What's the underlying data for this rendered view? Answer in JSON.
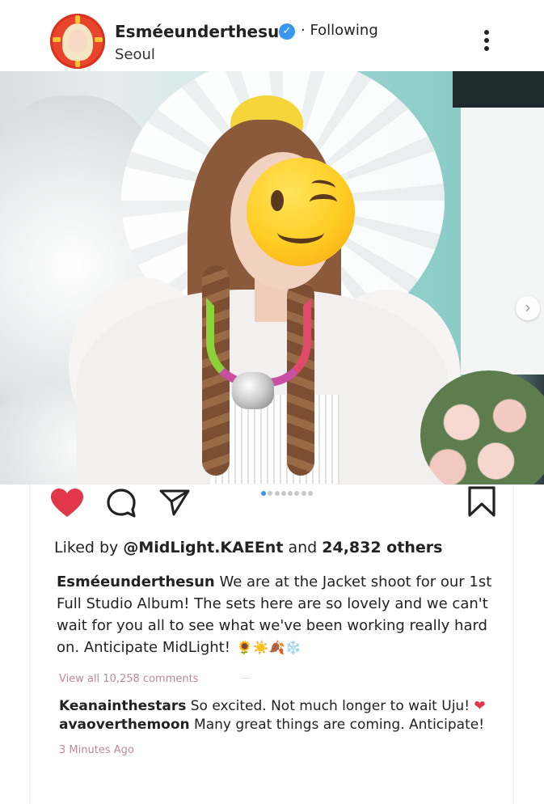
{
  "post": {
    "username": "Esméeunderthesun",
    "following_label": "· Following",
    "location": "Seoul",
    "liked_by_prefix": "Liked by",
    "liked_by_user": "@MidLight.KAEEnt",
    "liked_by_and": "and",
    "liked_by_others": "24,832 others",
    "caption_user": "Esméeunderthesun",
    "caption_text": "We are at the Jacket shoot for our 1st Full Studio Album! The sets here are so lovely and we can't wait for you all to see what we've been working really hard on. Anticipate MidLight!",
    "caption_emojis": "🌻☀️🍂❄️",
    "view_comments": "View all 10,258 comments",
    "comments": [
      {
        "user": "Keanainthestars",
        "text": "So excited. Not much longer to wait Uju!",
        "emoji": "❤"
      },
      {
        "user": "avaoverthemoon",
        "text": "Many great things are coming. Anticipate!",
        "emoji": ""
      }
    ],
    "timestamp": "3 Minutes Ago",
    "carousel": {
      "count": 8,
      "active_index": 0
    }
  },
  "icons": {
    "verified": "verified-badge-icon",
    "more": "more-options-icon",
    "like": "heart-icon",
    "comment": "comment-icon",
    "share": "share-icon",
    "save": "bookmark-icon",
    "next": "chevron-right-icon"
  },
  "colors": {
    "like_red": "#e2374a",
    "verified_blue": "#3897f0",
    "muted_pink": "#b98a9b"
  }
}
